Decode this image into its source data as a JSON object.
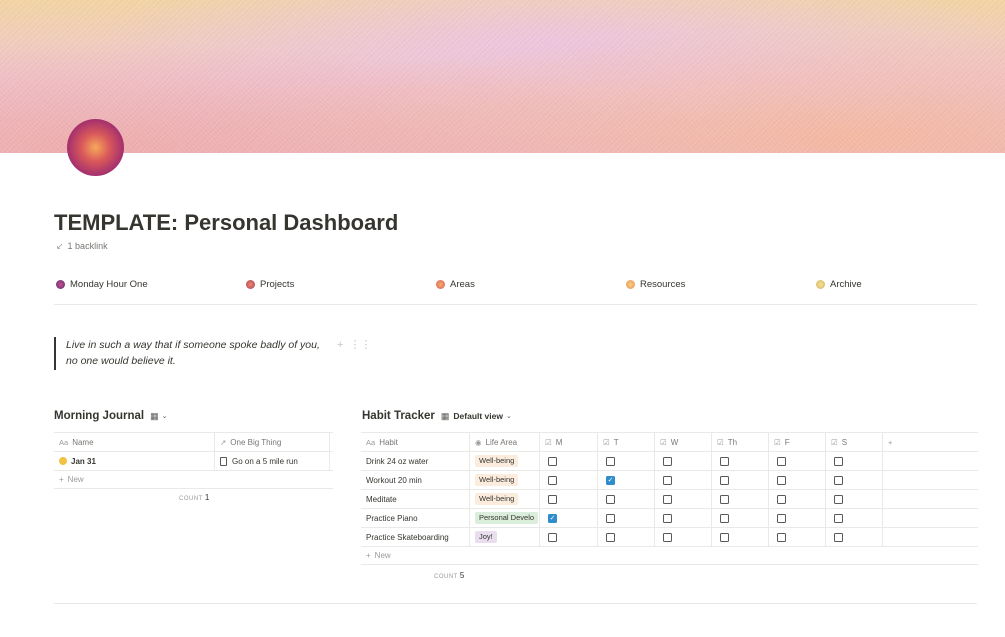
{
  "page": {
    "title": "TEMPLATE: Personal Dashboard",
    "backlink": "1 backlink"
  },
  "nav": [
    {
      "label": "Monday Hour One",
      "color": "#7a2f78"
    },
    {
      "label": "Projects",
      "color": "#c9575a"
    },
    {
      "label": "Areas",
      "color": "#e98b5a"
    },
    {
      "label": "Resources",
      "color": "#efae5d"
    },
    {
      "label": "Archive",
      "color": "#ead27a"
    }
  ],
  "quote": "Live in such a way that if someone spoke badly of you, no one would believe it.",
  "journal": {
    "title": "Morning Journal",
    "columns": [
      "Name",
      "One Big Thing"
    ],
    "rows": [
      {
        "name": "Jan 31",
        "thing": "Go on a 5 mile run"
      }
    ],
    "new_label": "New",
    "count_label": "COUNT",
    "count": "1"
  },
  "habits": {
    "title": "Habit Tracker",
    "view": "Default view",
    "columns": [
      "Habit",
      "Life Area",
      "M",
      "T",
      "W",
      "Th",
      "F",
      "S"
    ],
    "add": "+",
    "rows": [
      {
        "habit": "Drink 24 oz water",
        "area": "Well-being",
        "area_style": "wellbeing",
        "checks": [
          false,
          false,
          false,
          false,
          false,
          false
        ]
      },
      {
        "habit": "Workout 20 min",
        "area": "Well-being",
        "area_style": "wellbeing",
        "checks": [
          false,
          true,
          false,
          false,
          false,
          false
        ]
      },
      {
        "habit": "Meditate",
        "area": "Well-being",
        "area_style": "wellbeing",
        "checks": [
          false,
          false,
          false,
          false,
          false,
          false
        ]
      },
      {
        "habit": "Practice Piano",
        "area": "Personal Develo",
        "area_style": "personal",
        "checks": [
          true,
          false,
          false,
          false,
          false,
          false
        ]
      },
      {
        "habit": "Practice Skateboarding",
        "area": "Joy!",
        "area_style": "joy",
        "checks": [
          false,
          false,
          false,
          false,
          false,
          false
        ]
      }
    ],
    "new_label": "New",
    "count_label": "COUNT",
    "count": "5"
  }
}
